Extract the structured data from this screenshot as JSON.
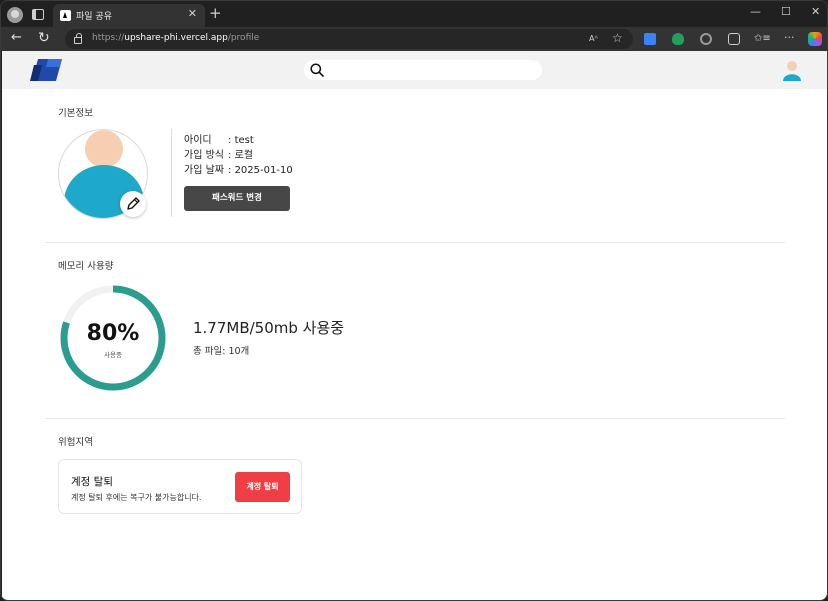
{
  "browser": {
    "tab_title": "파일 공유",
    "url_scheme": "https://",
    "url_host": "upshare-phi.vercel.app",
    "url_path": "/profile",
    "new_tab": "+",
    "tab_close": "✕",
    "win_minimize": "—",
    "win_maximize": "☐",
    "win_close": "✕",
    "back": "←",
    "refresh": "↻",
    "read_aloud": "Aᴬ",
    "favorite": "☆",
    "favorites_bar": "✩≡",
    "more": "···"
  },
  "header": {
    "search_placeholder": ""
  },
  "basic_info": {
    "title": "기본정보",
    "rows": [
      {
        "label": "아이디",
        "value": "test"
      },
      {
        "label": "가입 방식",
        "value": "로컬"
      },
      {
        "label": "가입 날짜",
        "value": "2025-01-10"
      }
    ],
    "separator": ":",
    "change_password_label": "패스워드 변경"
  },
  "memory": {
    "title": "메모리 사용량",
    "percent_label": "80%",
    "percent_value": 0.8,
    "percent_caption": "사용중",
    "usage_text": "1.77MB/50mb 사용중",
    "file_count_text": "총 파일: 10개"
  },
  "danger_zone": {
    "title": "위험지역",
    "card_title": "계정 탈퇴",
    "card_desc": "계정 탈퇴 후에는 복구가 불가능합니다.",
    "button_label": "계정 탈퇴"
  },
  "colors": {
    "ring_progress": "#2a9d8f",
    "ring_track": "#f1f1f1",
    "danger": "#ef3e44",
    "button_dark": "#474747",
    "avatar_skin": "#f6cfb3",
    "avatar_body": "#1ea8c9"
  }
}
